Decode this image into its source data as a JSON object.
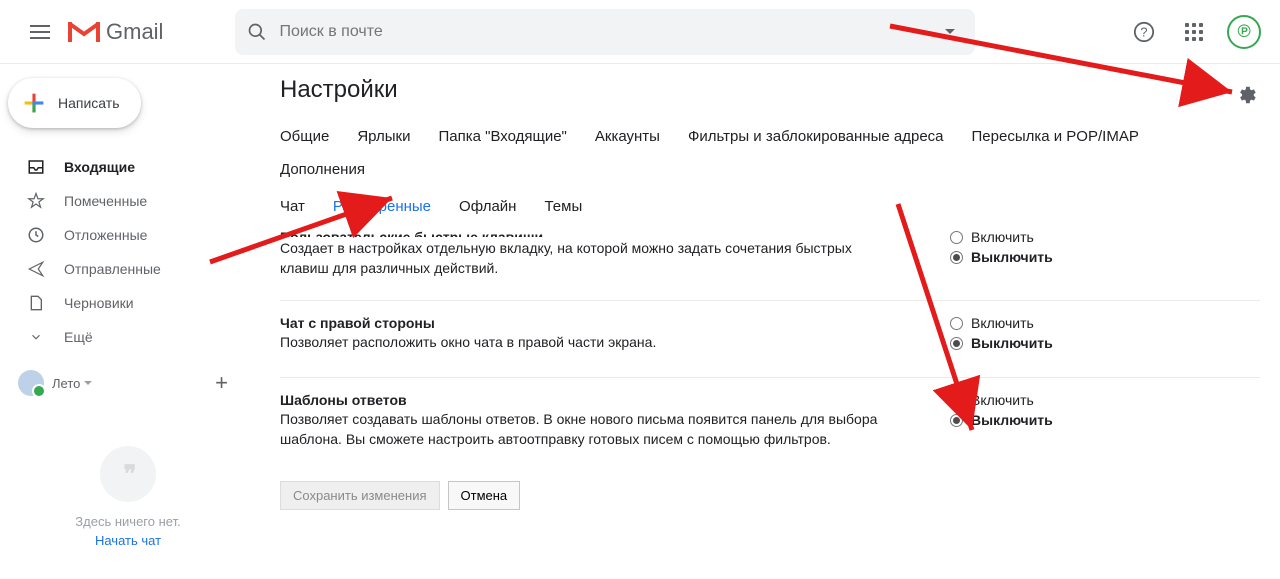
{
  "header": {
    "product": "Gmail",
    "search_placeholder": "Поиск в почте"
  },
  "compose": {
    "label": "Написать"
  },
  "sidebar": {
    "items": [
      {
        "label": "Входящие",
        "icon": "inbox"
      },
      {
        "label": "Помеченные",
        "icon": "star"
      },
      {
        "label": "Отложенные",
        "icon": "clock"
      },
      {
        "label": "Отправленные",
        "icon": "send"
      },
      {
        "label": "Черновики",
        "icon": "draft"
      },
      {
        "label": "Ещё",
        "icon": "chevron"
      }
    ],
    "hangouts_user": "Лето",
    "hangouts_empty": "Здесь ничего нет.",
    "hangouts_start": "Начать чат"
  },
  "main": {
    "title": "Настройки",
    "tabs_row1": [
      "Общие",
      "Ярлыки",
      "Папка \"Входящие\"",
      "Аккаунты",
      "Фильтры и заблокированные адреса",
      "Пересылка и POP/IMAP",
      "Дополнения"
    ],
    "tabs_row2": [
      "Чат",
      "Расширенные",
      "Офлайн",
      "Темы"
    ],
    "active_tab": "Расширенные",
    "settings": [
      {
        "title": "Пользовательские быстрые клавиши",
        "desc": "Создает в настройках отдельную вкладку, на которой можно задать сочетания быстрых клавиш для различных действий.",
        "options": [
          "Включить",
          "Выключить"
        ],
        "selected": 1
      },
      {
        "title": "Чат с правой стороны",
        "desc": "Позволяет расположить окно чата в правой части экрана.",
        "options": [
          "Включить",
          "Выключить"
        ],
        "selected": 1
      },
      {
        "title": "Шаблоны ответов",
        "desc": "Позволяет создавать шаблоны ответов. В окне нового письма появится панель для выбора шаблона. Вы сможете настроить автоотправку готовых писем с помощью фильтров.",
        "options": [
          "Включить",
          "Выключить"
        ],
        "selected": 1
      }
    ],
    "save_label": "Сохранить изменения",
    "cancel_label": "Отмена"
  }
}
